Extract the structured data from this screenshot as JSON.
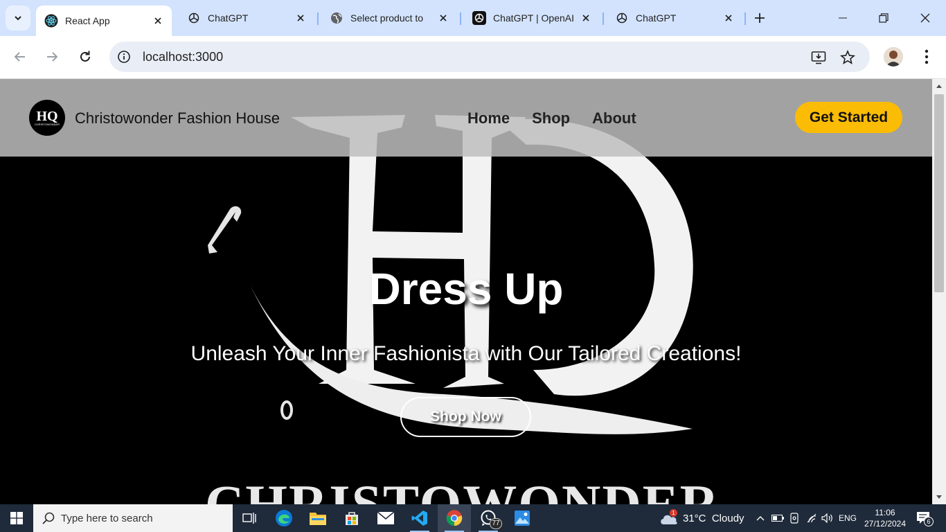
{
  "browser": {
    "tabs": [
      {
        "title": "React App",
        "icon": "react-icon",
        "active": true
      },
      {
        "title": "ChatGPT",
        "icon": "openai-icon",
        "active": false
      },
      {
        "title": "Select product to",
        "icon": "globe-icon",
        "active": false
      },
      {
        "title": "ChatGPT | OpenAI",
        "icon": "openai-icon",
        "active": false
      },
      {
        "title": "ChatGPT",
        "icon": "openai-icon",
        "active": false
      }
    ],
    "url": "localhost:3000",
    "accent": "#d3e3fd"
  },
  "site": {
    "brand": "Christowonder Fashion House",
    "logo_monogram": "HQ",
    "logo_small_text": "CHRISTOWONDER",
    "nav": [
      "Home",
      "Shop",
      "About"
    ],
    "cta_label": "Get Started",
    "cta_color": "#fbbc05",
    "hero": {
      "title": "Dress Up",
      "subtitle": "Unleash Your Inner Fashionista with Our Tailored Creations!",
      "button_label": "Shop Now",
      "background_text": "CHRISTOWONDER"
    }
  },
  "taskbar": {
    "search_placeholder": "Type here to search",
    "whatsapp_badge": "77",
    "weather_alert_badge": "1",
    "weather": "31°C  Cloudy",
    "language": "ENG",
    "time": "11:06",
    "date": "27/12/2024",
    "notifications_count": "6"
  }
}
